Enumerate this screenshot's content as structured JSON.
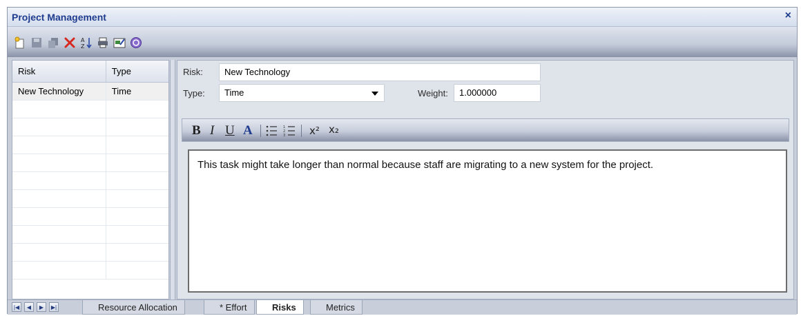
{
  "window": {
    "title": "Project Management",
    "close_glyph": "×"
  },
  "toolbar": {
    "icons": [
      "new-icon",
      "save-icon",
      "copy-icon",
      "delete-icon",
      "sort-icon",
      "print-icon",
      "export-icon",
      "help-icon"
    ]
  },
  "risk_list": {
    "headers": [
      "Risk",
      "Type"
    ],
    "rows": [
      {
        "risk": "New Technology",
        "type": "Time"
      }
    ]
  },
  "form": {
    "risk_label": "Risk:",
    "risk_value": "New Technology",
    "type_label": "Type:",
    "type_value": "Time",
    "weight_label": "Weight:",
    "weight_value": "1.000000"
  },
  "format_toolbar": {
    "bold": "B",
    "italic": "I",
    "underline": "U",
    "font_color": "A",
    "superscript": "x²",
    "subscript": "x₂"
  },
  "editor": {
    "text": "This task might take longer than normal because staff are migrating to a new system for the project."
  },
  "tabs": [
    {
      "label": "Resource Allocation",
      "active": false
    },
    {
      "label": "* Effort",
      "active": false
    },
    {
      "label": "Risks",
      "active": true
    },
    {
      "label": "Metrics",
      "active": false
    }
  ],
  "colors": {
    "title": "#1f3c8f",
    "delete": "#d6281f",
    "accent": "#2a4aa8"
  }
}
